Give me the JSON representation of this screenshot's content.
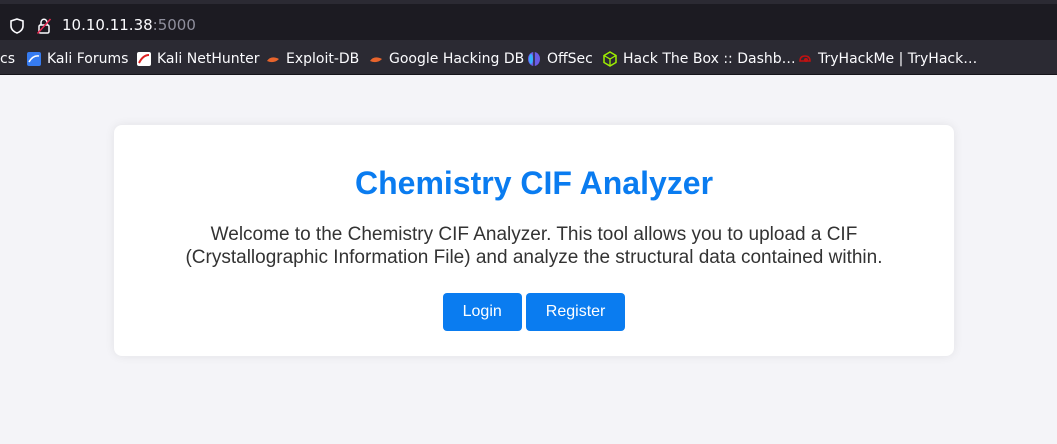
{
  "browser": {
    "url_host": "10.10.11.38",
    "url_port": ":5000",
    "bookmarks": [
      {
        "label": "cs",
        "icon": "none"
      },
      {
        "label": "Kali Forums",
        "icon": "kali-forums-icon"
      },
      {
        "label": "Kali NetHunter",
        "icon": "kali-nethunter-icon"
      },
      {
        "label": "Exploit-DB",
        "icon": "exploit-db-icon"
      },
      {
        "label": "Google Hacking DB",
        "icon": "ghdb-icon"
      },
      {
        "label": "OffSec",
        "icon": "offsec-icon"
      },
      {
        "label": "Hack The Box :: Dashb…",
        "icon": "htb-icon"
      },
      {
        "label": "TryHackMe | TryHack…",
        "icon": "tryhackme-icon"
      }
    ]
  },
  "main": {
    "title": "Chemistry CIF Analyzer",
    "description": "Welcome to the Chemistry CIF Analyzer. This tool allows you to upload a CIF (Crystallographic Information File) and analyze the structural data contained within.",
    "login_label": "Login",
    "register_label": "Register"
  },
  "colors": {
    "accent": "#0a7cf0",
    "page_bg": "#f4f4f8",
    "toolbar_bg": "#2b2a33"
  }
}
